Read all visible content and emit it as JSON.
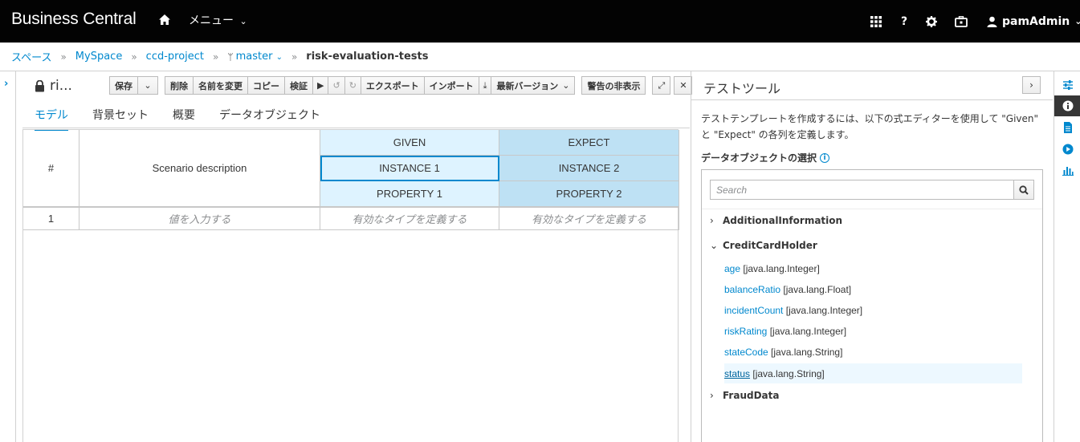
{
  "navbar": {
    "brand": "Business Central",
    "menu_label": "メニュー",
    "help_label": "?",
    "user_label": "pamAdmin"
  },
  "breadcrumb": {
    "items": [
      "スペース",
      "MySpace",
      "ccd-project"
    ],
    "branch": "master",
    "current": "risk-evaluation-tests",
    "sep": "»"
  },
  "editor": {
    "title": "ri...",
    "toolbar": {
      "save": "保存",
      "delete": "削除",
      "rename": "名前を変更",
      "copy": "コピー",
      "validate": "検証",
      "export": "エクスポート",
      "import": "インポート",
      "latest_version": "最新バージョン",
      "hide_alerts": "警告の非表示"
    },
    "tabs": [
      "モデル",
      "背景セット",
      "概要",
      "データオブジェクト"
    ],
    "grid": {
      "hash": "#",
      "scenario_description": "Scenario description",
      "given": "GIVEN",
      "expect": "EXPECT",
      "given_instance": "INSTANCE 1",
      "expect_instance": "INSTANCE 2",
      "given_property": "PROPERTY 1",
      "expect_property": "PROPERTY 2",
      "rows": [
        {
          "index": "1",
          "description": "値を入力する",
          "given_value": "有効なタイプを定義する",
          "expect_value": "有効なタイプを定義する"
        }
      ]
    }
  },
  "test_tools": {
    "title": "テストツール",
    "description": "テストテンプレートを作成するには、以下の式エディターを使用して \"Given\" と \"Expect\" の各列を定義します。",
    "section_label": "データオブジェクトの選択",
    "search_placeholder": "Search",
    "nodes": [
      {
        "name": "AdditionalInformation",
        "expanded": false
      },
      {
        "name": "CreditCardHolder",
        "expanded": true,
        "fields": [
          {
            "name": "age",
            "type": "[java.lang.Integer]"
          },
          {
            "name": "balanceRatio",
            "type": "[java.lang.Float]"
          },
          {
            "name": "incidentCount",
            "type": "[java.lang.Integer]"
          },
          {
            "name": "riskRating",
            "type": "[java.lang.Integer]"
          },
          {
            "name": "stateCode",
            "type": "[java.lang.String]"
          },
          {
            "name": "status",
            "type": "[java.lang.String]"
          }
        ]
      },
      {
        "name": "FraudData",
        "expanded": false
      }
    ]
  },
  "colors": {
    "navbar_bg": "#030303",
    "link": "#0088ce",
    "given_bg": "#def3ff",
    "expect_bg": "#bee1f4"
  },
  "icons": [
    "home-icon",
    "apps-grid-icon",
    "gear-icon",
    "briefcase-icon",
    "user-icon",
    "lock-icon",
    "search-icon",
    "info-icon",
    "sliders-icon",
    "document-icon",
    "play-circle-icon",
    "bar-chart-icon"
  ]
}
